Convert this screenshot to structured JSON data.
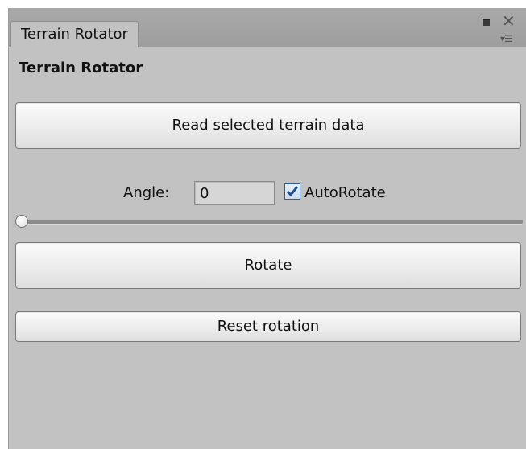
{
  "window": {
    "tab_title": "Terrain Rotator",
    "icons": {
      "maximize": "maximize-icon",
      "close": "close-icon",
      "menu": "menu-icon"
    }
  },
  "panel": {
    "title": "Terrain Rotator",
    "read_button_label": "Read selected terrain data",
    "angle_label": "Angle:",
    "angle_value": "0",
    "autorotate_label": "AutoRotate",
    "autorotate_checked": true,
    "slider_value": 0,
    "rotate_button_label": "Rotate",
    "reset_button_label": "Reset rotation"
  },
  "colors": {
    "panel_bg": "#c2c2c2",
    "checkbox_check": "#1f4e8c"
  }
}
